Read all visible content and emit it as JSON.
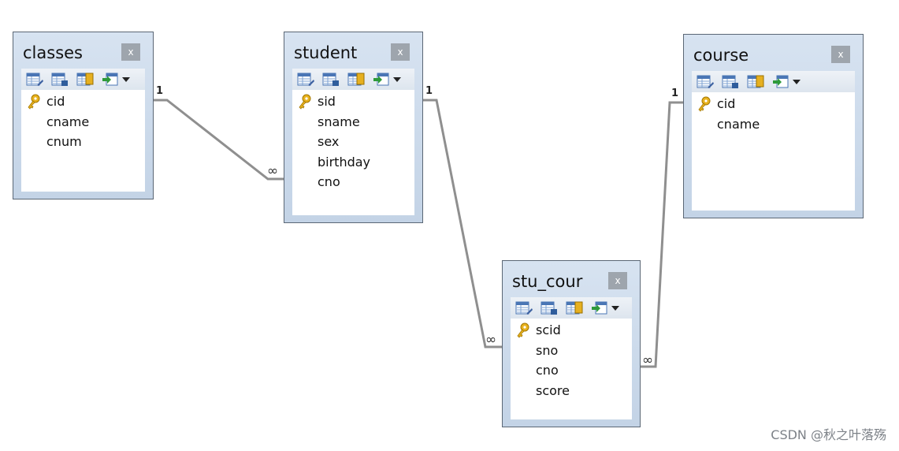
{
  "tables": [
    {
      "title": "classes",
      "close": "x",
      "fields": [
        {
          "name": "cid",
          "pk": true
        },
        {
          "name": "cname",
          "pk": false
        },
        {
          "name": "cnum",
          "pk": false
        }
      ]
    },
    {
      "title": "student",
      "close": "x",
      "fields": [
        {
          "name": "sid",
          "pk": true
        },
        {
          "name": "sname",
          "pk": false
        },
        {
          "name": "sex",
          "pk": false
        },
        {
          "name": "birthday",
          "pk": false
        },
        {
          "name": "cno",
          "pk": false
        }
      ]
    },
    {
      "title": "course",
      "close": "x",
      "fields": [
        {
          "name": "cid",
          "pk": true
        },
        {
          "name": "cname",
          "pk": false
        }
      ]
    },
    {
      "title": "stu_cour",
      "close": "x",
      "fields": [
        {
          "name": "scid",
          "pk": true
        },
        {
          "name": "sno",
          "pk": false
        },
        {
          "name": "cno",
          "pk": false
        },
        {
          "name": "score",
          "pk": false
        }
      ]
    }
  ],
  "relations": [
    {
      "from": "classes",
      "to": "student",
      "from_label": "1",
      "to_label": "∞"
    },
    {
      "from": "student",
      "to": "stu_cour",
      "from_label": "1",
      "to_label": "∞"
    },
    {
      "from": "course",
      "to": "stu_cour",
      "from_label": "1",
      "to_label": "∞"
    }
  ],
  "watermark": "CSDN @秋之叶落殇"
}
